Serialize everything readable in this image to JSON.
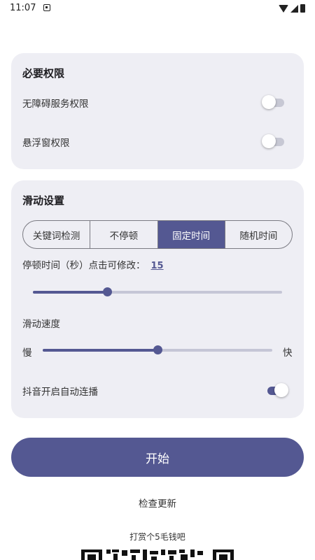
{
  "status_bar": {
    "time": "11:07"
  },
  "permissions": {
    "title": "必要权限",
    "accessibility_label": "无障碍服务权限",
    "accessibility_enabled": false,
    "overlay_label": "悬浮窗权限",
    "overlay_enabled": false
  },
  "swipe_settings": {
    "title": "滑动设置",
    "modes": [
      "关键词检测",
      "不停顿",
      "固定时间",
      "随机时间"
    ],
    "selected_mode": "固定时间",
    "pause_label": "停顿时间（秒）点击可修改：",
    "pause_value": "15",
    "pause_slider_fraction": 0.3,
    "speed_label": "滑动速度",
    "speed_slow": "慢",
    "speed_fast": "快",
    "speed_slider_fraction": 0.5,
    "douyin_label": "抖音开启自动连播",
    "douyin_enabled": true
  },
  "start_button_label": "开始",
  "check_update_label": "检查更新",
  "donate_text": "打赏个5毛钱吧",
  "colors": {
    "accent": "#545892",
    "card_bg": "#eeeef4",
    "track_off": "#c7c8d4"
  }
}
